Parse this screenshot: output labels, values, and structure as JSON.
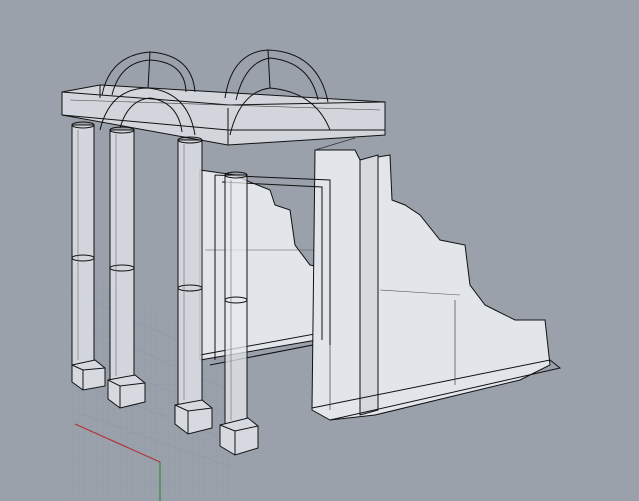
{
  "viewport": {
    "background_color": "#9aa1ab",
    "grid_color": "#8f9aa8",
    "x_axis_color": "#b0353a",
    "y_axis_color": "#2e8b3c",
    "shaded_fill": "#e2e5ea",
    "edge_color": "#111111"
  }
}
